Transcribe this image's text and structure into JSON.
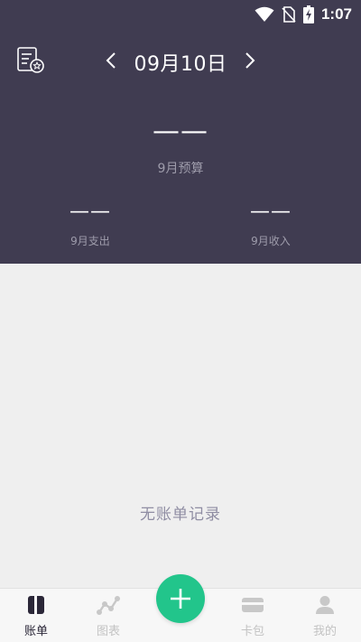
{
  "status_bar": {
    "time": "1:07"
  },
  "header": {
    "date": "09月10日",
    "budget_value": "——",
    "budget_label": "9月预算",
    "expense_value": "——",
    "expense_label": "9月支出",
    "income_value": "——",
    "income_label": "9月收入"
  },
  "main": {
    "empty_text": "无账单记录"
  },
  "tabs": [
    {
      "label": "账单",
      "icon": "book-icon",
      "active": true
    },
    {
      "label": "图表",
      "icon": "chart-icon",
      "active": false
    },
    {
      "label": "卡包",
      "icon": "card-icon",
      "active": false
    },
    {
      "label": "我的",
      "icon": "person-icon",
      "active": false
    }
  ],
  "colors": {
    "header_bg": "#403c51",
    "accent": "#22c58b",
    "page_bg": "#efefef"
  }
}
